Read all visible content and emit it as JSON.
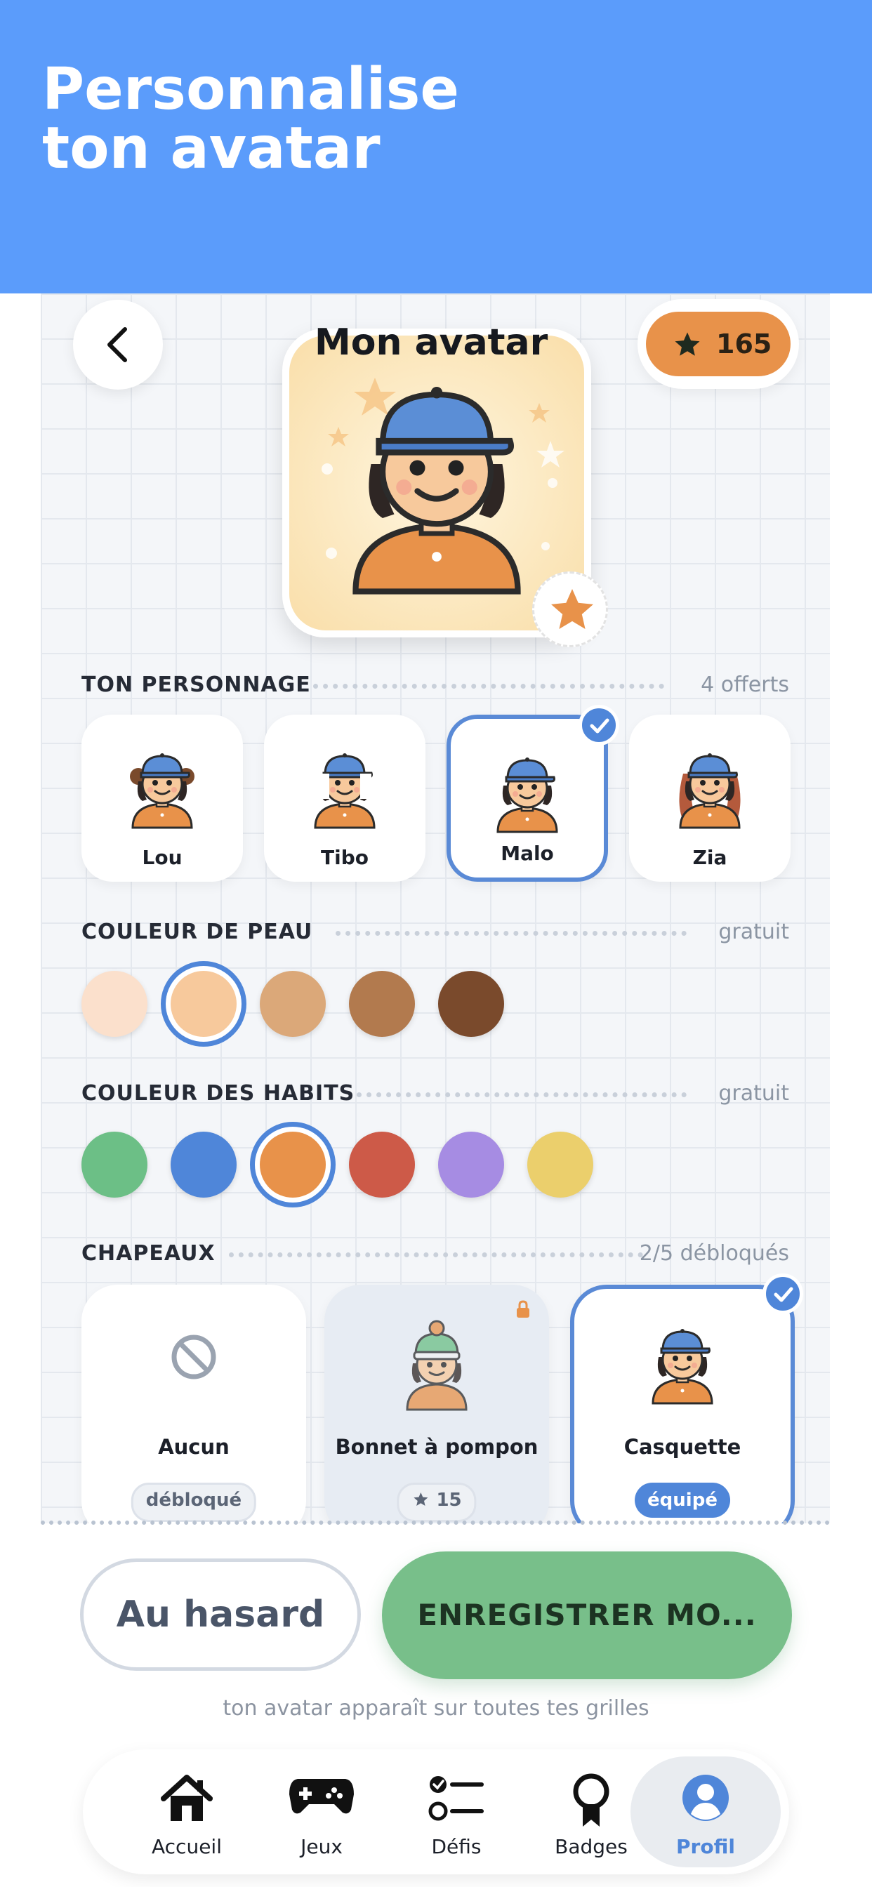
{
  "banner": {
    "title": "Personnalise\nton avatar"
  },
  "header": {
    "title": "Mon avatar",
    "coins": "165"
  },
  "sections": {
    "character": {
      "title": "TON PERSONNAGE",
      "meta": "4 offerts",
      "items": [
        {
          "name": "Lou",
          "selected": false
        },
        {
          "name": "Tibo",
          "selected": false
        },
        {
          "name": "Malo",
          "selected": true
        },
        {
          "name": "Zia",
          "selected": false
        }
      ]
    },
    "skin": {
      "title": "COULEUR DE PEAU",
      "meta": "gratuit",
      "colors": [
        "#fbe0cc",
        "#f7c99c",
        "#dba879",
        "#b27a4e",
        "#7a4a2c"
      ],
      "selected": 1
    },
    "clothes": {
      "title": "COULEUR DES HABITS",
      "meta": "gratuit",
      "colors": [
        "#6cbf86",
        "#4f86d9",
        "#e8924a",
        "#cd5a48",
        "#a68ce3",
        "#ebcf6c"
      ],
      "selected": 2
    },
    "hats": {
      "title": "CHAPEAUX",
      "meta": "2/5 débloqués",
      "items": [
        {
          "name": "Aucun",
          "status": "débloqué",
          "state": "unlocked",
          "icon": "none-icon"
        },
        {
          "name": "Bonnet à pompon",
          "price": "15",
          "state": "locked",
          "icon": "beanie-icon"
        },
        {
          "name": "Casquette",
          "status": "équipé",
          "state": "equipped",
          "icon": "cap-icon"
        }
      ]
    }
  },
  "actions": {
    "random_label": "Au hasard",
    "save_label": "ENREGISTRER MO...",
    "hint": "ton avatar apparaît sur toutes tes grilles"
  },
  "tabbar": {
    "items": [
      {
        "label": "Accueil",
        "icon": "home-icon"
      },
      {
        "label": "Jeux",
        "icon": "gamepad-icon"
      },
      {
        "label": "Défis",
        "icon": "checklist-icon"
      },
      {
        "label": "Badges",
        "icon": "badge-icon"
      },
      {
        "label": "Profil",
        "icon": "profile-icon",
        "active": true
      }
    ]
  },
  "colors": {
    "accent": "#4f86d9",
    "banner": "#5b9cfb",
    "save": "#78bf8a",
    "coin": "#e8924a"
  }
}
